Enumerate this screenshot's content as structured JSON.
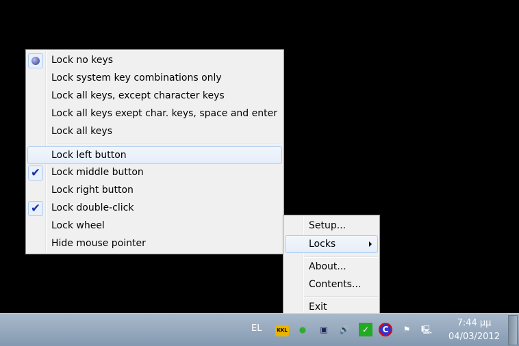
{
  "locks_menu": {
    "items": [
      {
        "label": "Lock no keys",
        "state": "radio"
      },
      {
        "label": "Lock system key combinations only"
      },
      {
        "label": "Lock all keys, except character keys"
      },
      {
        "label": "Lock all keys exept char. keys, space and enter"
      },
      {
        "label": "Lock all keys"
      },
      {
        "label": "Lock left button",
        "highlighted": true
      },
      {
        "label": "Lock middle button",
        "state": "checked"
      },
      {
        "label": "Lock right button"
      },
      {
        "label": "Lock double-click",
        "state": "checked"
      },
      {
        "label": "Lock wheel"
      },
      {
        "label": "Hide mouse pointer"
      }
    ]
  },
  "tray_menu": {
    "items": [
      {
        "label": "Setup..."
      },
      {
        "label": "Locks",
        "submenu": true
      },
      {
        "label": "About..."
      },
      {
        "label": "Contents..."
      },
      {
        "label": "Exit"
      }
    ]
  },
  "taskbar": {
    "language": "EL",
    "time": "7:44 μμ",
    "date": "04/03/2012",
    "tray_icons": [
      "kkl-lock-icon",
      "usb-device-icon",
      "network-computer-icon",
      "speaker-icon",
      "green-check-icon",
      "c-logo-icon",
      "action-center-flag-icon",
      "network-icon"
    ],
    "kkl_text": "KKL"
  }
}
